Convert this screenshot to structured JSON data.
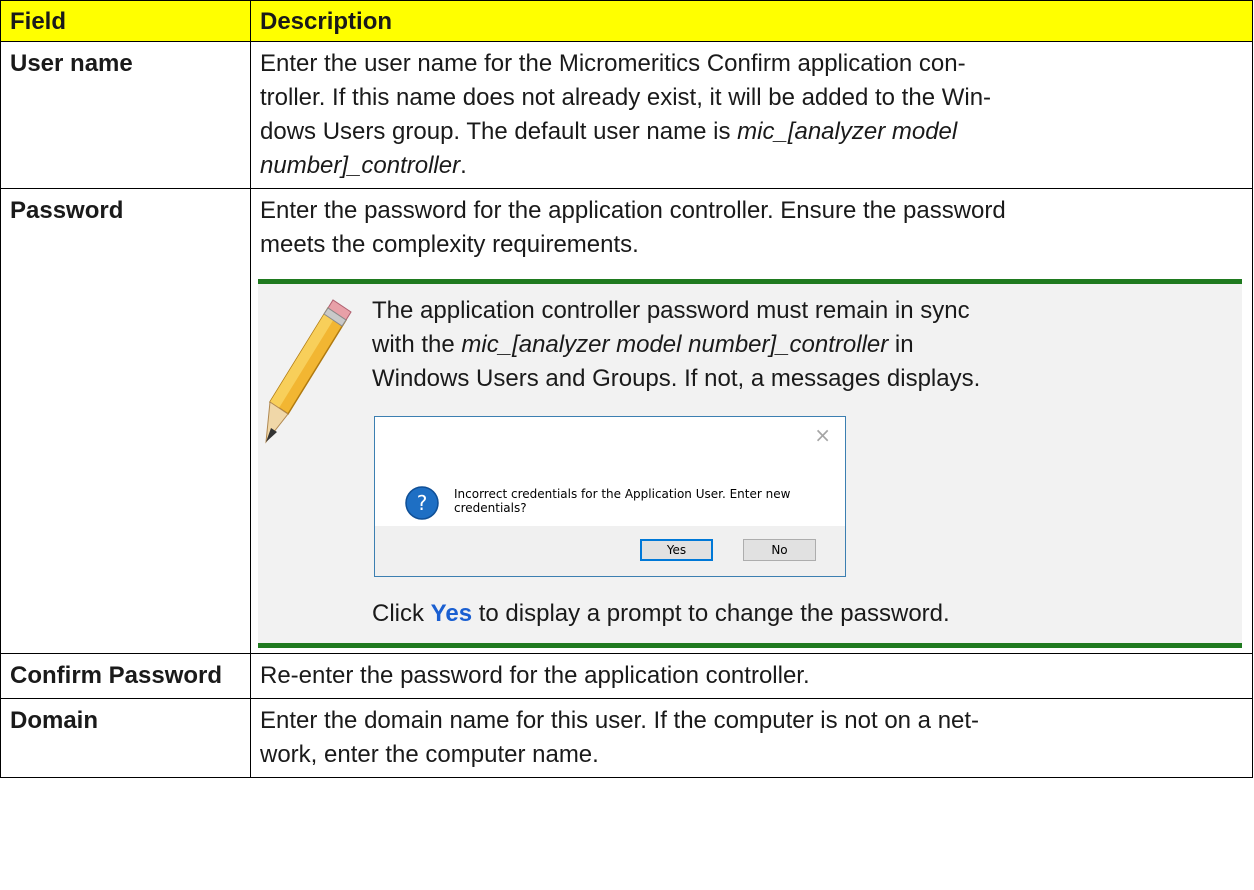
{
  "header": {
    "field": "Field",
    "description": "Description"
  },
  "rows": {
    "user_name": {
      "field": "User name",
      "desc_a": "Enter the user name for the Micromeritics Confirm application con-",
      "desc_b": "troller. If this name does not already exist, it will be added to the Win-",
      "desc_c": "dows Users group. The default user name is ",
      "desc_d_italic": "mic_[analyzer model",
      "desc_e_italic": "number]_controller",
      "desc_f": "."
    },
    "password": {
      "field": "Password",
      "desc_a": "Enter the password for the application controller. Ensure the password",
      "desc_b": "meets the complexity requirements.",
      "note": {
        "line1": "The application controller password must remain in sync",
        "line2_a": "with the ",
        "line2_b_italic": "mic_[analyzer model number]_controller",
        "line2_c": " in",
        "line3": "Windows Users and Groups. If not, a messages displays.",
        "dialog": {
          "close_glyph": "×",
          "message_line1": "Incorrect credentials for the Application User. Enter new",
          "message_line2": "credentials?",
          "yes_label": "Yes",
          "no_label": "No"
        },
        "click_a": "Click ",
        "click_yes": "Yes",
        "click_b": " to display a prompt to change the password."
      }
    },
    "confirm_password": {
      "field": "Confirm Password",
      "desc": "Re-enter the password for the application controller."
    },
    "domain": {
      "field": "Domain",
      "desc_a": "Enter the domain name for this user. If the computer is not on a net-",
      "desc_b": "work, enter the computer name."
    }
  },
  "colors": {
    "header_bg": "#ffff00",
    "note_rule": "#1f7a1f",
    "note_bg": "#f2f2f2",
    "link_blue": "#1a5fd1",
    "dialog_icon": "#1e6fc4"
  },
  "icons": {
    "note": "pencil-icon",
    "dialog": "question-icon",
    "close": "close-icon"
  }
}
